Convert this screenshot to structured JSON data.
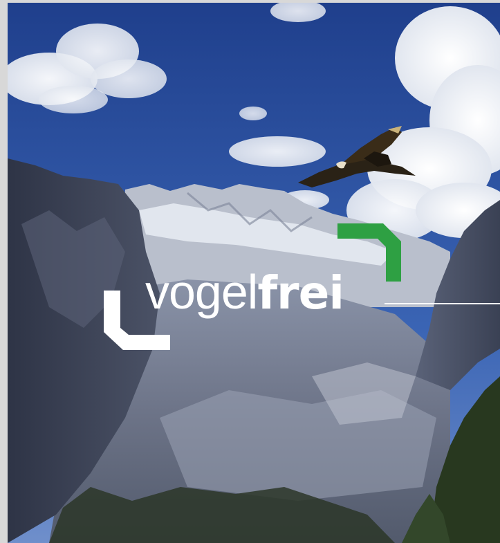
{
  "logo": {
    "part_light": "vogel",
    "part_bold": "frei",
    "text_color": "#ffffff",
    "accent_color": "#2ea043"
  },
  "scene": {
    "subject": "mountain-valley-with-glacier",
    "bird": "bearded-vulture-icon",
    "sky_color": "#2a4f9c",
    "cloud_color": "#f2f4f8",
    "rock_color": "#4d5468"
  }
}
